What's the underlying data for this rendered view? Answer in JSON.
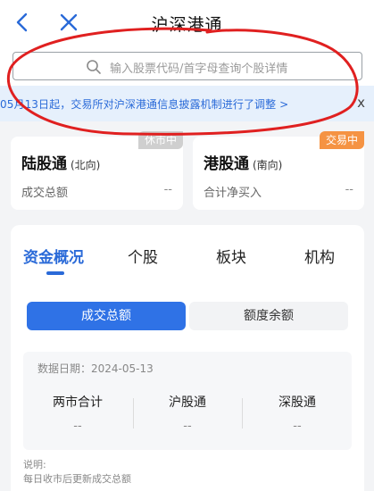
{
  "nav": {
    "title": "沪深港通"
  },
  "search": {
    "placeholder": "输入股票代码/首字母查询个股详情"
  },
  "notice": {
    "text": "05月13日起，交易所对沪深港通信息披露机制进行了调整 >",
    "close": "x"
  },
  "cards": {
    "north": {
      "title": "陆股通",
      "subtitle": "(北向)",
      "badge": "休市中",
      "label": "成交总额",
      "value": "--"
    },
    "south": {
      "title": "港股通",
      "subtitle": "(南向)",
      "badge": "交易中",
      "label": "合计净买入",
      "value": "--"
    }
  },
  "tabs": [
    "资金概况",
    "个股",
    "板块",
    "机构"
  ],
  "segments": {
    "active": "成交总额",
    "inactive": "额度余额"
  },
  "stats": {
    "date_label": "数据日期：",
    "date": "2024-05-13",
    "items": [
      {
        "name": "两市合计",
        "value": "--"
      },
      {
        "name": "沪股通",
        "value": "--"
      },
      {
        "name": "深股通",
        "value": "--"
      }
    ]
  },
  "note": {
    "title": "说明:",
    "text": "每日收市后更新成交总额"
  },
  "colors": {
    "accent": "#2a6ad8",
    "badge_trading": "#f59343",
    "badge_closed": "#cfcfcf",
    "annotation": "#e02020"
  }
}
